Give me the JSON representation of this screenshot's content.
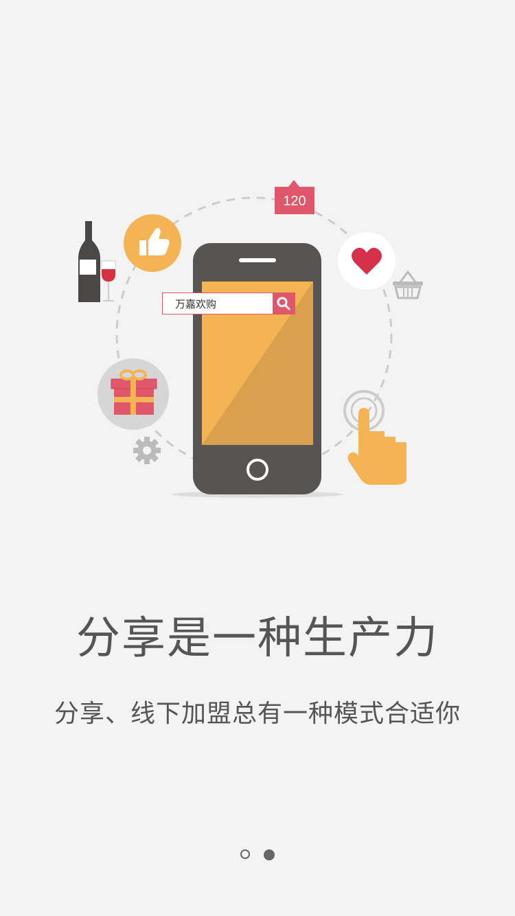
{
  "illustration": {
    "search_text": "万嘉欢购",
    "badge_count": "120",
    "icons": [
      "thumbs-up-icon",
      "heart-icon",
      "basket-icon",
      "gift-icon",
      "gear-icon",
      "wine-icon",
      "tap-hand-icon",
      "phone-icon",
      "search-icon"
    ]
  },
  "headline": "分享是一种生产力",
  "subline": "分享、线下加盟总有一种模式合适你",
  "pager": {
    "total": 2,
    "active_index": 1
  },
  "colors": {
    "background": "#f3f3f3",
    "accent_red": "#e0566b",
    "accent_orange": "#f4b454",
    "phone_body": "#575452",
    "text": "#555555"
  }
}
